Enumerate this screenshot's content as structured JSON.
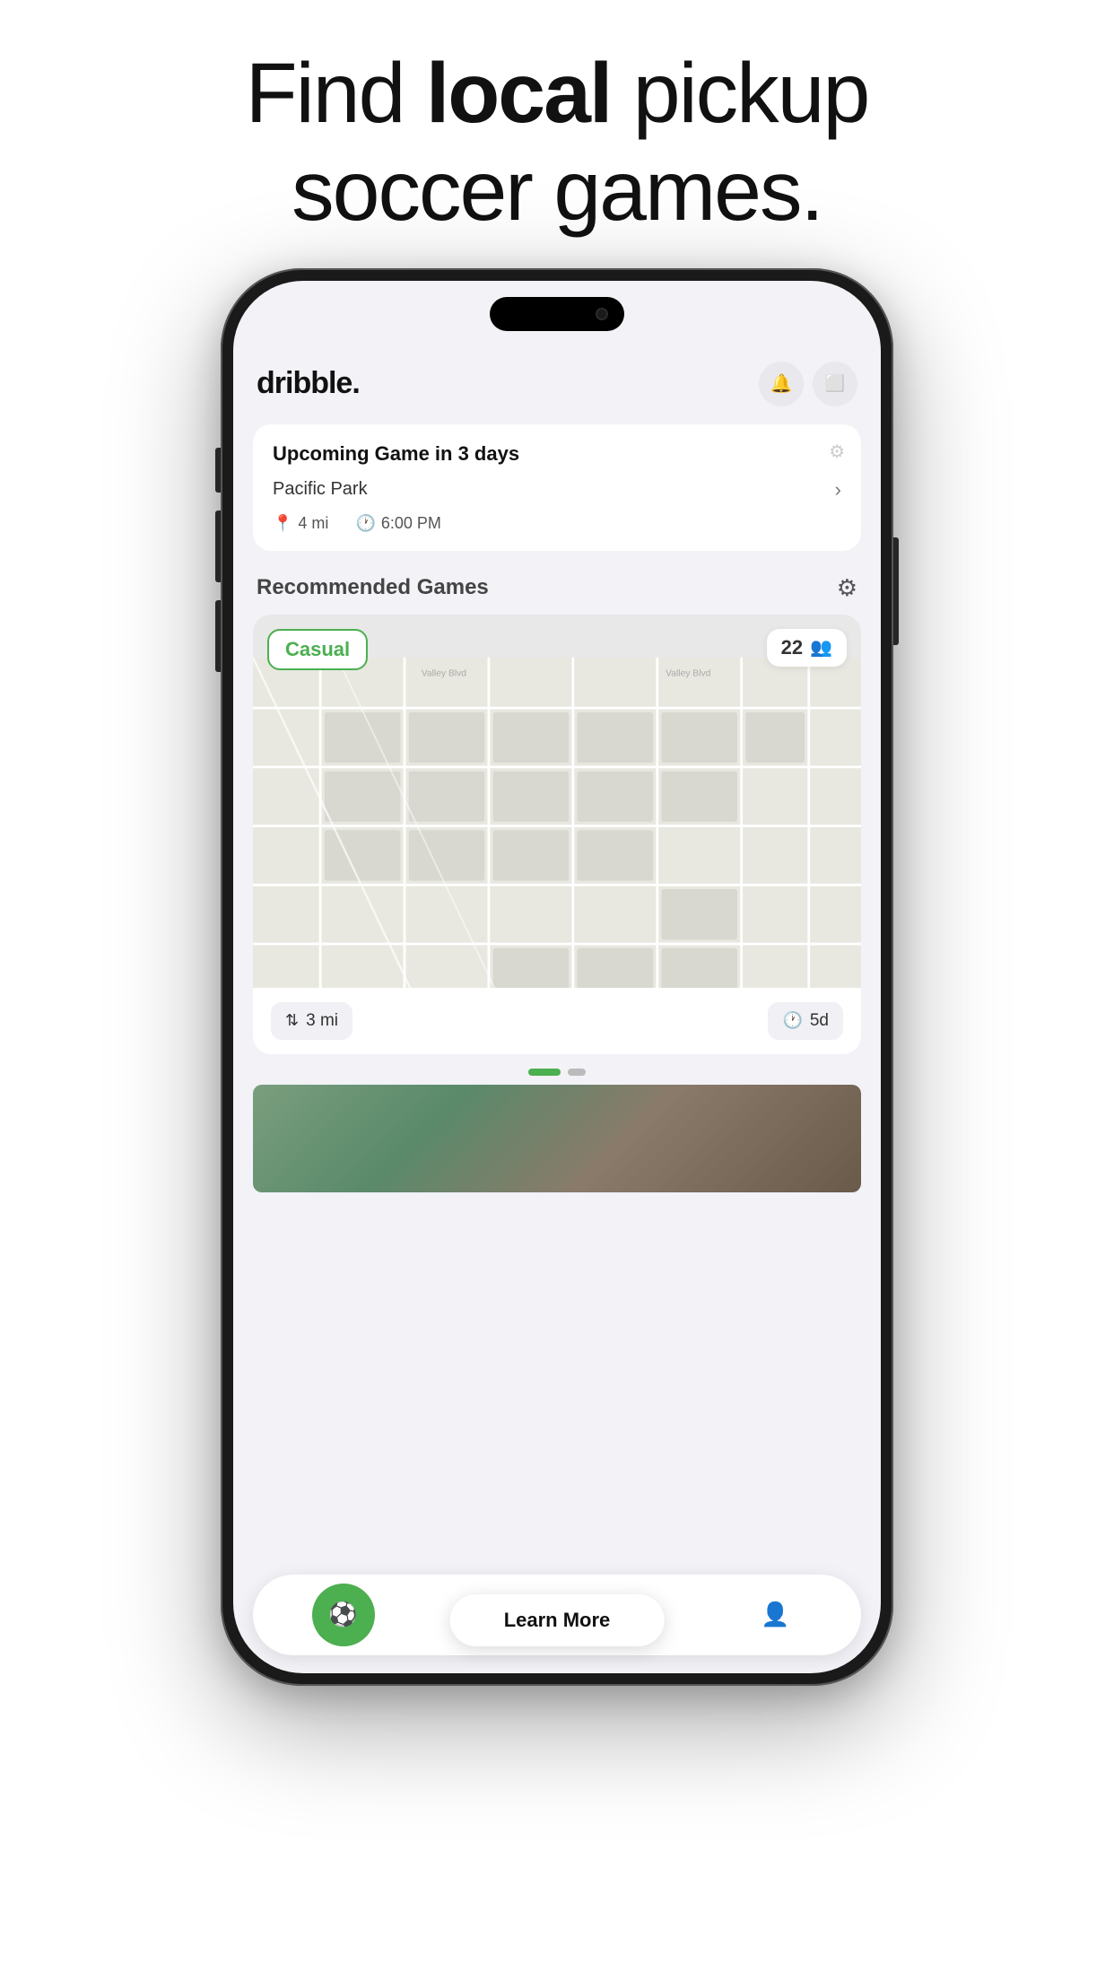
{
  "hero": {
    "line1_normal": "Find ",
    "line1_bold": "local",
    "line1_rest": " pickup",
    "line2": "soccer games."
  },
  "app": {
    "logo": "dribble.",
    "header_icons": {
      "bell": "🔔",
      "message": "💬"
    }
  },
  "upcoming_card": {
    "title": "Upcoming Game in 3 days",
    "location": "Pacific Park",
    "distance": "4 mi",
    "time": "6:00 PM"
  },
  "recommended": {
    "section_title": "Recommended Games",
    "card": {
      "type_label": "Casual",
      "player_count": "22",
      "distance": "3 mi",
      "days_away": "5d"
    }
  },
  "pagination": {
    "active_index": 0,
    "total": 2
  },
  "bottom_nav": {
    "items": [
      {
        "name": "home",
        "icon": "⚽",
        "active": true
      },
      {
        "name": "explore",
        "icon": "◎",
        "active": false
      },
      {
        "name": "add",
        "icon": "+",
        "active": false
      },
      {
        "name": "profile",
        "icon": "👤",
        "active": false
      }
    ]
  },
  "learn_more_label": "Learn More"
}
